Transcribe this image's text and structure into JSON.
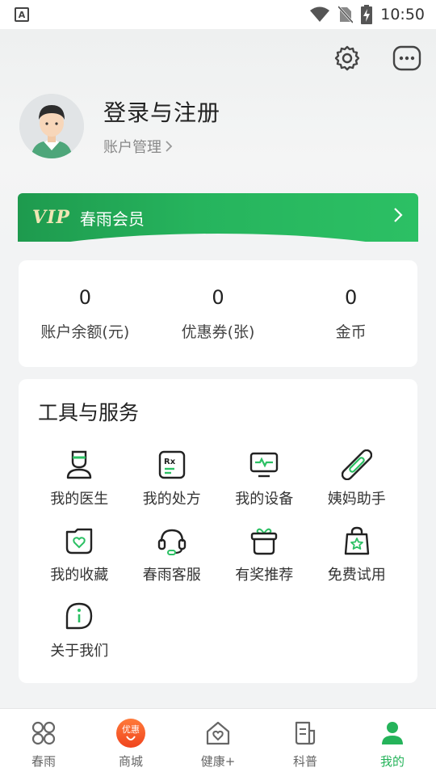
{
  "status_bar": {
    "time": "10:50",
    "app_icon": "A"
  },
  "header": {
    "icons": [
      "settings-icon",
      "more-icon"
    ]
  },
  "profile": {
    "title": "登录与注册",
    "account_link": "账户管理"
  },
  "vip": {
    "logo": "VIP",
    "label": "春雨会员"
  },
  "stats": [
    {
      "value": "0",
      "label": "账户余额(元)"
    },
    {
      "value": "0",
      "label": "优惠券(张)"
    },
    {
      "value": "0",
      "label": "金币"
    }
  ],
  "tools": {
    "title": "工具与服务",
    "items": [
      {
        "label": "我的医生",
        "icon": "doctor-icon"
      },
      {
        "label": "我的处方",
        "icon": "prescription-icon"
      },
      {
        "label": "我的设备",
        "icon": "device-icon"
      },
      {
        "label": "姨妈助手",
        "icon": "pad-icon"
      },
      {
        "label": "我的收藏",
        "icon": "favorite-icon"
      },
      {
        "label": "春雨客服",
        "icon": "headset-icon"
      },
      {
        "label": "有奖推荐",
        "icon": "gift-icon"
      },
      {
        "label": "免费试用",
        "icon": "trial-bag-icon"
      },
      {
        "label": "关于我们",
        "icon": "info-icon"
      }
    ]
  },
  "bottom_nav": {
    "items": [
      {
        "label": "春雨",
        "icon": "home-grid-icon",
        "active": false
      },
      {
        "label": "商城",
        "icon": "promo-icon",
        "badge": "优惠",
        "active": false
      },
      {
        "label": "健康+",
        "icon": "health-house-icon",
        "active": false
      },
      {
        "label": "科普",
        "icon": "article-icon",
        "active": false
      },
      {
        "label": "我的",
        "icon": "user-icon",
        "active": true
      }
    ]
  },
  "colors": {
    "accent": "#25b35a",
    "vip_gradient_start": "#1e9a4e",
    "vip_gradient_end": "#2cc064",
    "promo": "#f0441e"
  }
}
